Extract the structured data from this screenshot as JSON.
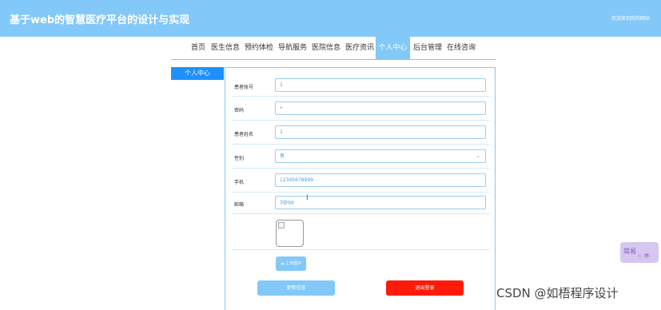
{
  "header": {
    "site_title": "基于web的智慧医疗平台的设计与实现",
    "welcome_text": "欢迎来到我的网站"
  },
  "nav": {
    "items": [
      "首页",
      "医生信息",
      "预约体检",
      "导航服务",
      "医院信息",
      "医疗资讯",
      "个人中心",
      "后台管理",
      "在线咨询"
    ],
    "active": "个人中心"
  },
  "side_menu": {
    "items": [
      "个人中心"
    ]
  },
  "form": {
    "fields": [
      {
        "label": "患者账号",
        "value": "1"
      },
      {
        "label": "密码",
        "value": "•"
      },
      {
        "label": "患者姓名",
        "value": "1"
      },
      {
        "label": "性别",
        "value": "男",
        "type": "select"
      },
      {
        "label": "手机",
        "value": "12345678999"
      },
      {
        "label": "邮箱",
        "value": "3@qq"
      }
    ],
    "upload_button": "上传图片",
    "update_button": "更新信息",
    "logout_button": "退出登录"
  },
  "widget": {
    "label": "简易",
    "label2": "☆ 👁"
  },
  "watermark": "CSDN @如梧程序设计",
  "colors": {
    "header": "#82c8f8",
    "side_menu": "#1e90ff",
    "logout": "#ff1a0a"
  }
}
